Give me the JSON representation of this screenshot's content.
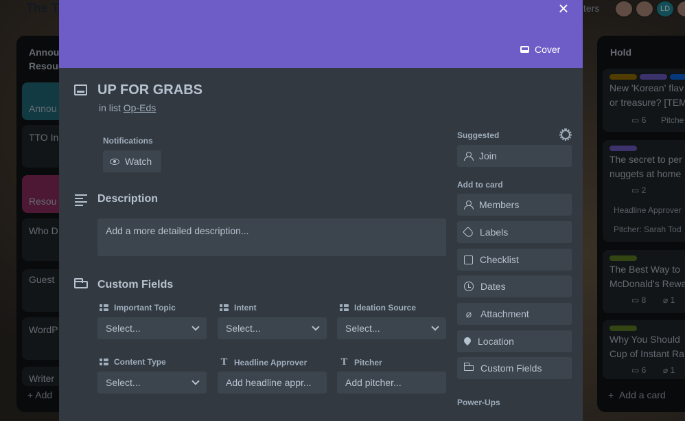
{
  "board": {
    "title": "The Ta",
    "filters_label": "ters",
    "avatar_initials": "LD"
  },
  "left_list": {
    "title_line1": "Annou",
    "title_line2": "Resour",
    "cards": [
      "Annou",
      "TTO In",
      "Resou",
      "Who D",
      "Guest",
      "WordP",
      "Writer"
    ],
    "add_card": "Add"
  },
  "right_list": {
    "title": "Hold",
    "cards": [
      {
        "line1": "New 'Korean' flav",
        "line2": "or treasure? [TEM",
        "comments": "6",
        "extra": "Pitche"
      },
      {
        "line1": "The secret to per",
        "line2": "nuggets at home",
        "comments": "2",
        "field1": "Headline Approver",
        "field2": "Pitcher: Sarah Tod"
      },
      {
        "line1": "The Best Way to",
        "line2": "McDonald's Rewa",
        "comments": "8",
        "attachments": "1"
      },
      {
        "line1": "Why You Should",
        "line2": "Cup of Instant Ra",
        "comments": "6",
        "attachments": "1"
      }
    ],
    "add_card": "Add a card"
  },
  "modal": {
    "close_symbol": "×",
    "cover_label": "Cover",
    "title": "UP FOR GRABS",
    "in_list_prefix": "in list",
    "list_name": "Op-Eds",
    "notifications_label": "Notifications",
    "watch_label": "Watch",
    "description_title": "Description",
    "description_placeholder": "Add a more detailed description...",
    "custom_fields_title": "Custom Fields",
    "fields": [
      {
        "label": "Important Topic",
        "value": "Select...",
        "type": "dropdown"
      },
      {
        "label": "Intent",
        "value": "Select...",
        "type": "dropdown"
      },
      {
        "label": "Ideation Source",
        "value": "Select...",
        "type": "dropdown"
      },
      {
        "label": "Content Type",
        "value": "Select...",
        "type": "dropdown"
      },
      {
        "label": "Headline Approver",
        "value": "Add headline appr...",
        "type": "text"
      },
      {
        "label": "Pitcher",
        "value": "Add pitcher...",
        "type": "text"
      }
    ],
    "sidebar": {
      "suggested_label": "Suggested",
      "join_label": "Join",
      "add_to_card_label": "Add to card",
      "members_label": "Members",
      "labels_label": "Labels",
      "checklist_label": "Checklist",
      "dates_label": "Dates",
      "attachment_label": "Attachment",
      "location_label": "Location",
      "custom_fields_label": "Custom Fields",
      "powerups_label": "Power-Ups"
    }
  },
  "colors": {
    "cover": "#6e5dc6",
    "modal_bg": "#323940",
    "button_bg": "#3c454d"
  }
}
